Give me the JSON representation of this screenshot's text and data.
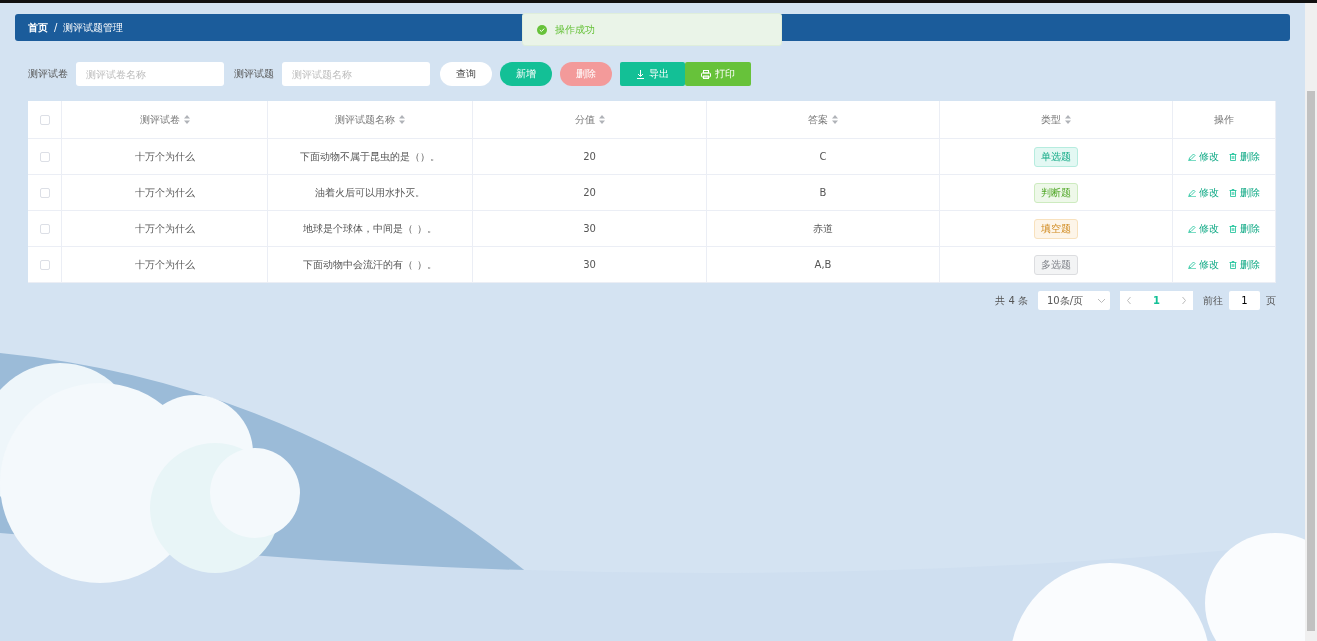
{
  "breadcrumb": {
    "items": [
      "首页",
      "测评试题管理"
    ],
    "separator": "/"
  },
  "toast": {
    "message": "操作成功"
  },
  "search": {
    "fields": [
      {
        "label": "测评试卷",
        "placeholder": "测评试卷名称"
      },
      {
        "label": "测评试题",
        "placeholder": "测评试题名称"
      }
    ],
    "buttons": [
      {
        "label": "查询",
        "kind": "query",
        "disabled": false
      },
      {
        "label": "新增",
        "kind": "add",
        "disabled": false
      },
      {
        "label": "删除",
        "kind": "delete",
        "disabled": true
      },
      {
        "label": "导出",
        "kind": "export",
        "disabled": false
      },
      {
        "label": "打印",
        "kind": "print",
        "disabled": false
      }
    ]
  },
  "table": {
    "header_checked": false,
    "columns": [
      {
        "label": "测评试卷",
        "sortable": true
      },
      {
        "label": "测评试题名称",
        "sortable": true
      },
      {
        "label": "分值",
        "sortable": true
      },
      {
        "label": "答案",
        "sortable": true
      },
      {
        "label": "类型",
        "sortable": true
      },
      {
        "label": "操作",
        "sortable": false
      }
    ],
    "rows": [
      {
        "checked": false,
        "paper": "十万个为什么",
        "question": "下面动物不属于昆虫的是（）。",
        "score": "20",
        "answer": "C",
        "type": {
          "label": "单选题",
          "kind": "success"
        },
        "actions": [
          "修改",
          "删除"
        ]
      },
      {
        "checked": false,
        "paper": "十万个为什么",
        "question": "油着火后可以用水扑灭。",
        "score": "20",
        "answer": "B",
        "type": {
          "label": "判断题",
          "kind": "green"
        },
        "actions": [
          "修改",
          "删除"
        ]
      },
      {
        "checked": false,
        "paper": "十万个为什么",
        "question": "地球是个球体，中间是（ ）。",
        "score": "30",
        "answer": "赤道",
        "type": {
          "label": "填空题",
          "kind": "warning"
        },
        "actions": [
          "修改",
          "删除"
        ]
      },
      {
        "checked": false,
        "paper": "十万个为什么",
        "question": "下面动物中会流汗的有（ ）。",
        "score": "30",
        "answer": "A,B",
        "type": {
          "label": "多选题",
          "kind": "info"
        },
        "actions": [
          "修改",
          "删除"
        ]
      }
    ]
  },
  "pagination": {
    "total": "共 4 条",
    "page_size": "10条/页",
    "pages": [
      {
        "label": "1",
        "selected": true
      }
    ],
    "goto_label": "前往",
    "goto_value": "1",
    "goto_suffix": "页"
  }
}
